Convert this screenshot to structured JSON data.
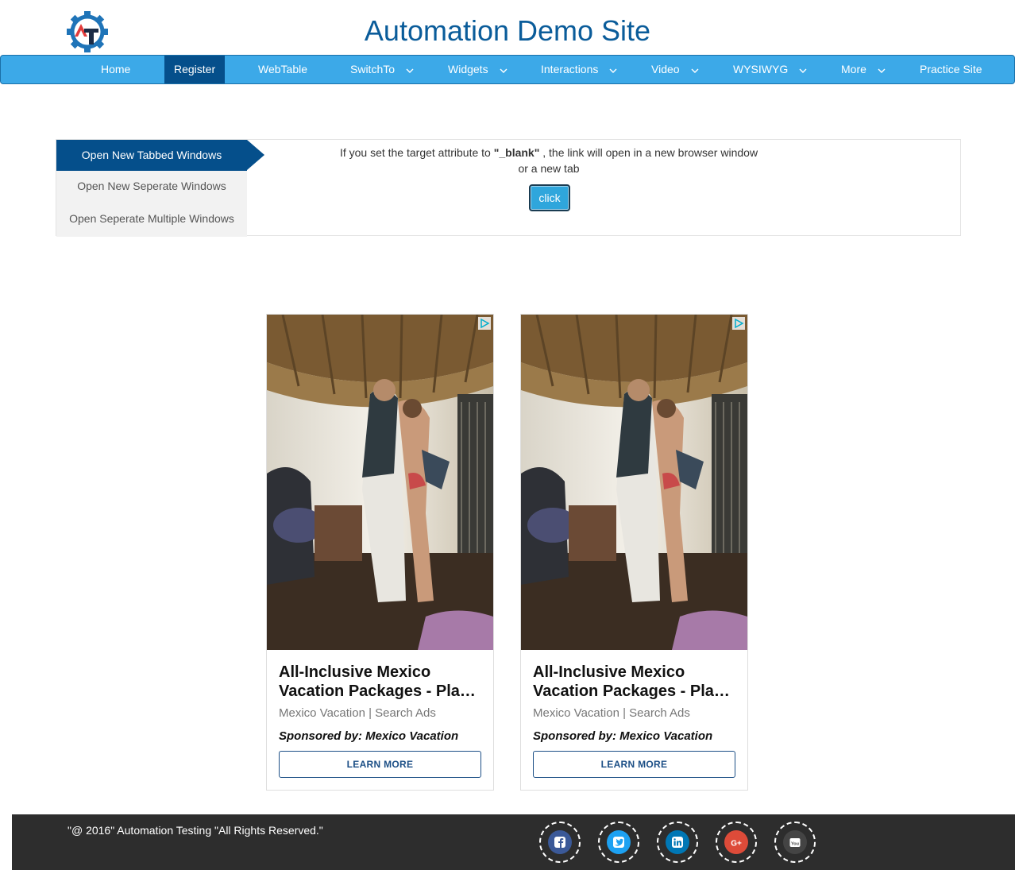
{
  "header": {
    "title": "Automation Demo Site",
    "logo_text": "AT"
  },
  "nav": {
    "items": [
      {
        "label": "Home",
        "dropdown": false
      },
      {
        "label": "Register",
        "dropdown": false,
        "active": true
      },
      {
        "label": "WebTable",
        "dropdown": false
      },
      {
        "label": "SwitchTo",
        "dropdown": true
      },
      {
        "label": "Widgets",
        "dropdown": true
      },
      {
        "label": "Interactions",
        "dropdown": true
      },
      {
        "label": "Video",
        "dropdown": true
      },
      {
        "label": "WYSIWYG",
        "dropdown": true
      },
      {
        "label": "More",
        "dropdown": true
      },
      {
        "label": "Practice Site",
        "dropdown": false
      }
    ]
  },
  "windows": {
    "tabs": [
      {
        "label": "Open New Tabbed Windows",
        "active": true
      },
      {
        "label": "Open New Seperate Windows"
      },
      {
        "label": "Open Seperate Multiple Windows"
      }
    ],
    "description_prefix": "If you set the target attribute to ",
    "description_code": "\"_blank\"",
    "description_suffix": " , the link will open in a new browser window",
    "description_line2": "or a new tab",
    "button_label": "click"
  },
  "ads": [
    {
      "title_line1": "All-Inclusive Mexico",
      "title_line2": "Vacation Packages - Pla…",
      "source": "Mexico Vacation | Search Ads",
      "sponsor": "Sponsored by: Mexico Vacation",
      "cta": "LEARN MORE"
    },
    {
      "title_line1": "All-Inclusive Mexico",
      "title_line2": "Vacation Packages - Pla…",
      "source": "Mexico Vacation | Search Ads",
      "sponsor": "Sponsored by: Mexico Vacation",
      "cta": "LEARN MORE"
    }
  ],
  "footer": {
    "copyright": "\"@ 2016\" Automation Testing \"All Rights Reserved.\"",
    "social": [
      {
        "icon": "facebook-icon",
        "glyph": "f",
        "color": "#3b5998"
      },
      {
        "icon": "twitter-icon",
        "glyph": "t",
        "color": "#1da1f2"
      },
      {
        "icon": "linkedin-icon",
        "glyph": "in",
        "color": "#0077b5"
      },
      {
        "icon": "google-plus-icon",
        "glyph": "G+",
        "color": "#dd4b39"
      },
      {
        "icon": "youtube-icon",
        "glyph": "You",
        "color": "#444444"
      }
    ]
  },
  "colors": {
    "brand": "#0a5c9a",
    "navbar": "#3ca9e8",
    "nav_active": "#054f8b",
    "footer": "#2d2d2d"
  }
}
